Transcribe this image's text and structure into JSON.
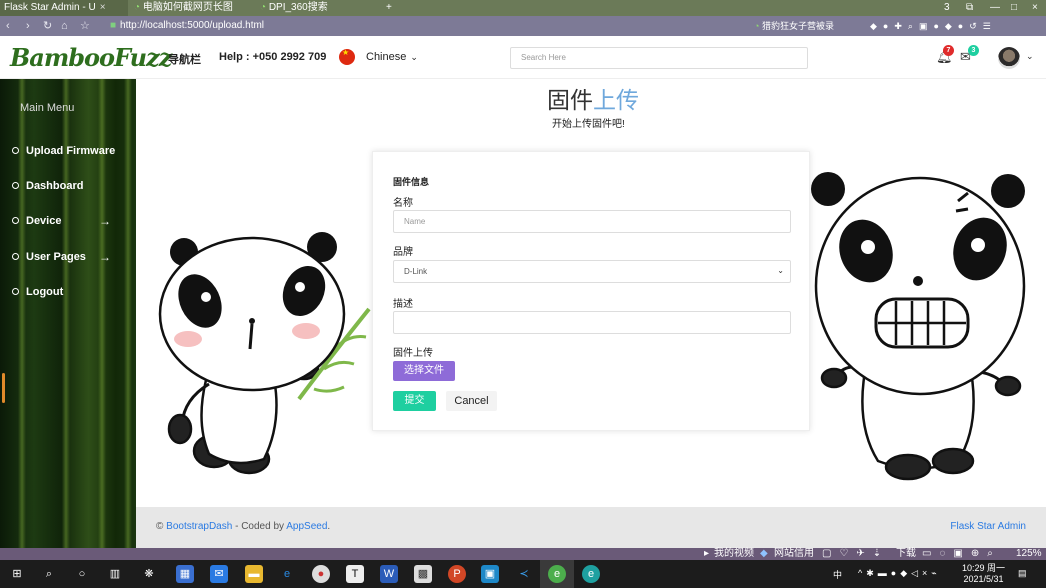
{
  "browser": {
    "tabs": [
      {
        "label": "Flask Star Admin - U",
        "close": "×"
      },
      {
        "label": "电脑如何截网页长图",
        "close": ""
      },
      {
        "label": "DPI_360搜索",
        "close": ""
      }
    ],
    "new_tab": "+",
    "tab_count": "3",
    "window_controls": [
      "—",
      "□",
      "×"
    ],
    "url": "http://localhost:5000/upload.html",
    "search_hint": "猎豹狂女子营被录",
    "nav_icons": [
      "back-icon",
      "forward-icon",
      "reload-icon",
      "home-icon",
      "star-icon"
    ]
  },
  "header": {
    "logo": "BambooFuzz",
    "nav_label": "导航栏",
    "help": "Help : +050 2992 709",
    "language": "Chinese",
    "search_placeholder": "Search Here",
    "notifications_count": "7",
    "messages_count": "3"
  },
  "sidebar": {
    "title": "Main Menu",
    "items": [
      {
        "label": "Upload Firmware",
        "has_arrow": false
      },
      {
        "label": "Dashboard",
        "has_arrow": false
      },
      {
        "label": "Device",
        "has_arrow": true
      },
      {
        "label": "User Pages",
        "has_arrow": true
      },
      {
        "label": "Logout",
        "has_arrow": false
      }
    ]
  },
  "main": {
    "title_a": "固件",
    "title_b": "上传",
    "subtitle": "开始上传固件吧!",
    "form": {
      "section_title": "固件信息",
      "name_label": "名称",
      "name_placeholder": "Name",
      "brand_label": "品牌",
      "brand_value": "D-Link",
      "desc_label": "描述",
      "desc_value": "",
      "upload_label": "固件上传",
      "choose_file": "选择文件",
      "submit": "提交",
      "cancel": "Cancel"
    }
  },
  "footer": {
    "copyright": "©",
    "link1": "BootstrapDash",
    "coded_by": " - Coded by ",
    "link2": "AppSeed",
    "period": ".",
    "right_link": "Flask Star Admin"
  },
  "statusbar": {
    "video": "我的视频",
    "credit": "网站信用",
    "download": "下载",
    "zoom": "125%"
  },
  "taskbar": {
    "time": "10:29 周一",
    "date": "2021/5/31",
    "ime": "中"
  },
  "colors": {
    "accent_blue": "#6fa8dc",
    "file_button": "#8e6bd8",
    "submit_button": "#1ecfa0",
    "link": "#2a7ae2"
  }
}
